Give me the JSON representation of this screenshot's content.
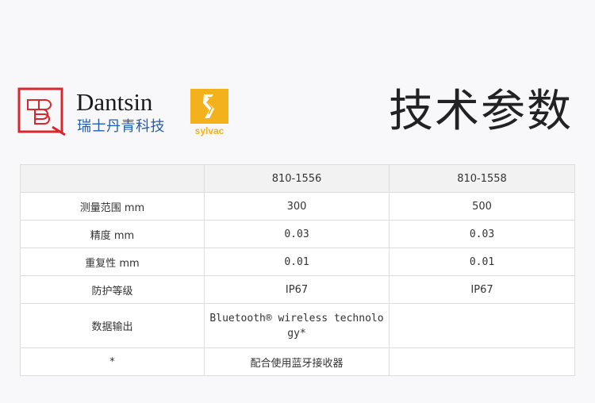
{
  "brand": {
    "name": "Dantsin",
    "subtitle": "瑞士丹青科技",
    "partner": "sylvac"
  },
  "title": "技术参数",
  "colors": {
    "dantsin_red": "#d9272e",
    "dantsin_blue": "#1f5fb0",
    "sylvac_yellow": "#f3b21b"
  },
  "table": {
    "headers": [
      "",
      "810-1556",
      "810-1558"
    ],
    "rows": [
      {
        "label": "测量范围 mm",
        "v1": "300",
        "v2": "500"
      },
      {
        "label": "精度 mm",
        "v1": "0.03",
        "v2": "0.03"
      },
      {
        "label": "重复性 mm",
        "v1": "0.01",
        "v2": "0.01"
      },
      {
        "label": "防护等级",
        "v1": "IP67",
        "v2": "IP67"
      },
      {
        "label": "数据输出",
        "v1": "Bluetooth® wireless technology*",
        "v2": ""
      },
      {
        "label": "*",
        "v1": "配合使用蓝牙接收器",
        "v2": ""
      }
    ]
  }
}
